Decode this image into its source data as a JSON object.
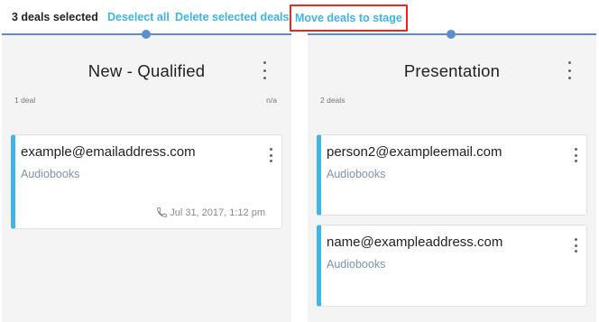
{
  "toolbar": {
    "selected_text": "3 deals selected",
    "deselect_label": "Deselect all",
    "delete_label": "Delete selected deals",
    "move_label": "Move deals to stage"
  },
  "columns": [
    {
      "title": "New - Qualified",
      "deal_count": "1 deal",
      "amount": "n/a",
      "cards": [
        {
          "email": "example@emailaddress.com",
          "product": "Audiobooks",
          "activity": "Jul 31, 2017, 1:12 pm",
          "activity_icon": "phone-icon"
        }
      ]
    },
    {
      "title": "Presentation",
      "deal_count": "2 deals",
      "amount": "",
      "cards": [
        {
          "email": "person2@exampleemail.com",
          "product": "Audiobooks"
        },
        {
          "email": "name@exampleaddress.com",
          "product": "Audiobooks"
        }
      ]
    }
  ],
  "colors": {
    "accent": "#3fb4e5",
    "stage_line": "#5b8fc9",
    "highlight_border": "#e8291c"
  }
}
